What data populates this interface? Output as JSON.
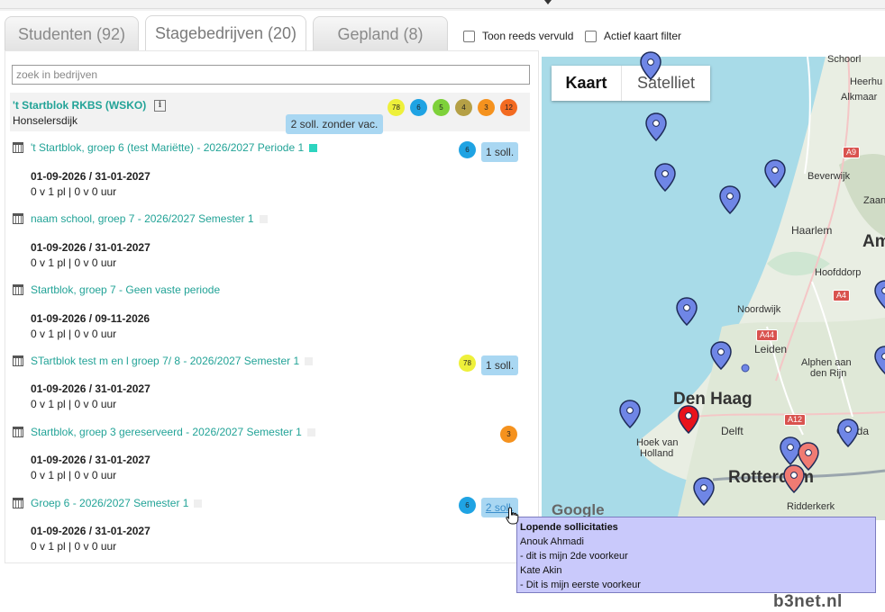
{
  "tabs": [
    {
      "label": "Studenten (92)"
    },
    {
      "label": "Stagebedrijven (20)"
    },
    {
      "label": "Gepland (8)"
    }
  ],
  "filters": {
    "show_filled": "Toon reeds vervuld",
    "active_map": "Actief kaart filter"
  },
  "search": {
    "placeholder": "zoek in bedrijven"
  },
  "company": {
    "name": "'t Startblok RKBS (WSKO)",
    "city": "Honselersdijk",
    "info_icon": "i",
    "badges": [
      {
        "value": "78",
        "color": "#eef03a"
      },
      {
        "value": "6",
        "color": "#1fa3e3"
      },
      {
        "value": "5",
        "color": "#7ed13a"
      },
      {
        "value": "4",
        "color": "#b5a046"
      },
      {
        "value": "3",
        "color": "#f5921e"
      },
      {
        "value": "12",
        "color": "#f36b21"
      }
    ],
    "tooltip": "2 soll. zonder vac."
  },
  "vacancies": [
    {
      "title": "'t Startblok, groep 6 (test Mariëtte) - 2026/2027 Periode 1",
      "dates": "01-09-2026 / 31-01-2027",
      "places": "0 v 1 pl | 0 v 0 uur",
      "badge": "6",
      "badge_color": "#1fa3e3",
      "soll": "1 soll."
    },
    {
      "title": "naam school, groep 7 - 2026/2027 Semester 1",
      "dates": "01-09-2026 / 31-01-2027",
      "places": "0 v 1 pl | 0 v 0 uur"
    },
    {
      "title": "Startblok, groep 7 - Geen vaste periode",
      "dates": "01-09-2026 / 09-11-2026",
      "places": "0 v 1 pl | 0 v 0 uur"
    },
    {
      "title": "STartblok test m en l groep 7/ 8 - 2026/2027 Semester 1",
      "dates": "01-09-2026 / 31-01-2027",
      "places": "0 v 1 pl | 0 v 0 uur",
      "badge": "78",
      "badge_color": "#eef03a",
      "soll": "1 soll."
    },
    {
      "title": "Startblok, groep 3 gereserveerd - 2026/2027 Semester 1",
      "dates": "01-09-2026 / 31-01-2027",
      "places": "0 v 1 pl | 0 v 0 uur",
      "badge": "3",
      "badge_color": "#f5921e"
    },
    {
      "title": "Groep 6 - 2026/2027 Semester 1",
      "dates": "01-09-2026 / 31-01-2027",
      "places": "0 v 1 pl | 0 v 0 uur",
      "badge": "6",
      "badge_color": "#1fa3e3",
      "soll": "2 soll."
    }
  ],
  "map": {
    "type_kaart": "Kaart",
    "type_satelliet": "Satelliet",
    "attribution": "Google",
    "cities": {
      "schoorl": "Schoorl",
      "heerhugo": "Heerhu",
      "alkmaar": "Alkmaar",
      "beverwijk": "Beverwijk",
      "zaan": "Zaan",
      "haarlem": "Haarlem",
      "am": "Am",
      "hoofddorp": "Hoofddorp",
      "noordwijk": "Noordwijk",
      "leiden": "Leiden",
      "alphen": "Alphen aan",
      "alphen2": "den Rijn",
      "den_haag": "Den Haag",
      "delft": "Delft",
      "hoek1": "Hoek van",
      "hoek2": "Holland",
      "gouda": "Gouda",
      "rotterdam": "Rotterdam",
      "ridderkerk": "Ridderkerk"
    },
    "roads": {
      "a9": "A9",
      "a4": "A4",
      "a44": "A44",
      "a12": "A12"
    }
  },
  "tooltip_popup": {
    "title": "Lopende sollicitaties",
    "lines": [
      "Anouk Ahmadi",
      "- dit is mijn 2de voorkeur",
      "Kate Akin",
      "- Dit is mijn eerste voorkeur"
    ]
  },
  "brand": "b3net.nl"
}
